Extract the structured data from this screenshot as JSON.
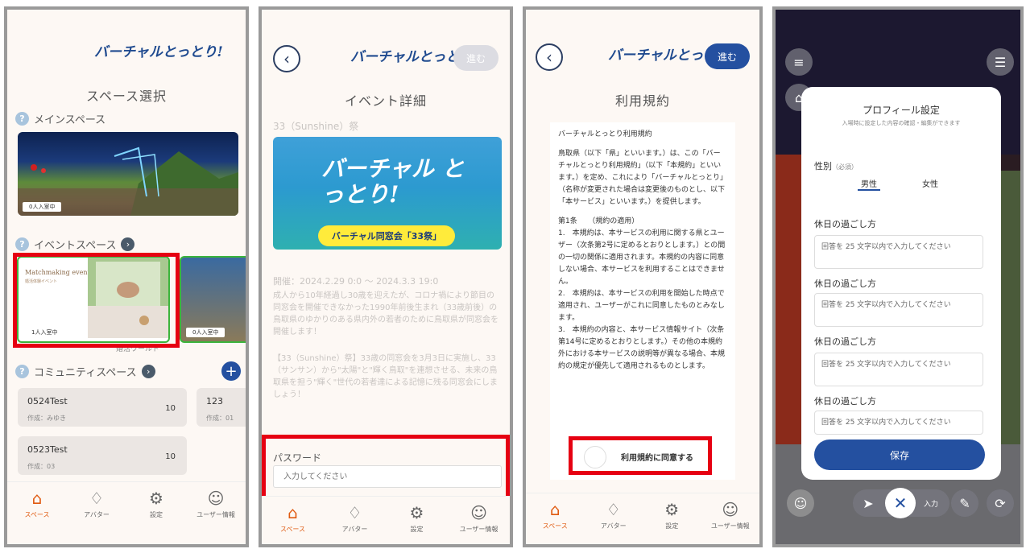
{
  "logo": "バーチャルとっとり!",
  "tabs": [
    {
      "label": "スペース",
      "icon": "home-icon"
    },
    {
      "label": "アバター",
      "icon": "shirt-icon"
    },
    {
      "label": "設定",
      "icon": "gear-icon"
    },
    {
      "label": "ユーザー情報",
      "icon": "user-icon"
    }
  ],
  "screen1": {
    "title": "スペース選択",
    "main_section": "メインスペース",
    "main_badge": "0人入室中",
    "event_section": "イベントスペース",
    "event_card1_title": "Matchmaking event",
    "event_card1_sub": "婚活体験イベント",
    "event_card1_badge": "1人入室中",
    "event_card2_badge": "0人入室中",
    "event_card_caption": "婚活ワールド",
    "community_section": "コミュニティスペース",
    "communities": [
      {
        "name": "0524Test",
        "creator": "作成：みゆき",
        "count": "10"
      },
      {
        "name": "123",
        "creator": "作成：01",
        "count": ""
      },
      {
        "name": "0523Test",
        "creator": "作成：03",
        "count": "10"
      }
    ]
  },
  "screen2": {
    "next_label": "進む",
    "title": "イベント詳細",
    "event_name": "33（Sunshine）祭",
    "banner_logo": "バーチャル とっとり!",
    "banner_sub": "バーチャル同窓会「33祭」",
    "date": "開催：2024.2.29 0:0 ～ 2024.3.3 19:0",
    "desc1": "成人から10年経過し30歳を迎えたが、コロナ禍により節目の同窓会を開催できなかった1990年前後生まれ（33歳前後）の鳥取県のゆかりのある県内外の若者のために鳥取県が同窓会を開催します！",
    "desc2": "【33（Sunshine）祭】33歳の同窓会を3月3日に実施し、33（サンサン）から\"太陽\"と\"輝く鳥取\"を連想させる、未来の鳥取県を担う\"輝く\"世代の若者達による記憶に残る同窓会にしましょう！",
    "password_label": "パスワード",
    "password_placeholder": "入力してください"
  },
  "screen3": {
    "next_label": "進む",
    "title": "利用規約",
    "terms_heading": "バーチャルとっとり利用規約",
    "terms_p1": "鳥取県（以下「県」といいます。）は、この「バーチャルとっとり利用規約」（以下「本規約」といいます。）を定め、これにより「バーチャルとっとり」（名称が変更された場合は変更後のものとし、以下「本サービス」といいます。）を提供します。",
    "terms_p2": "第1条　　（規約の適用）\n1.　本規約は、本サービスの利用に関する県とユーザー（次条第2号に定めるとおりとします。）との間の一切の関係に適用されます。本規約の内容に同意しない場合、本サービスを利用することはできません。\n2.　本規約は、本サービスの利用を開始した時点で適用され、ユーザーがこれに同意したものとみなします。\n3.　本規約の内容と、本サービス情報サイト（次条第14号に定めるとおりとします。）その他の本規約外における本サービスの説明等が異なる場合、本規約の規定が優先して適用されるものとします。",
    "agree_label": "利用規約に同意する"
  },
  "screen4": {
    "title": "プロフィール設定",
    "subtitle": "入場時に設定した内容の確認・編集ができます",
    "gender_label": "性別",
    "gender_required": "（必須）",
    "gender_male": "男性",
    "gender_female": "女性",
    "question_label": "休日の過ごし方",
    "placeholder": "回答を 25 文字以内で入力してください",
    "save_label": "保存",
    "bottom_partial": "入力"
  },
  "colors": {
    "accent_orange": "#e05a10",
    "navy": "#2450a0",
    "highlight_red": "#e60012"
  }
}
